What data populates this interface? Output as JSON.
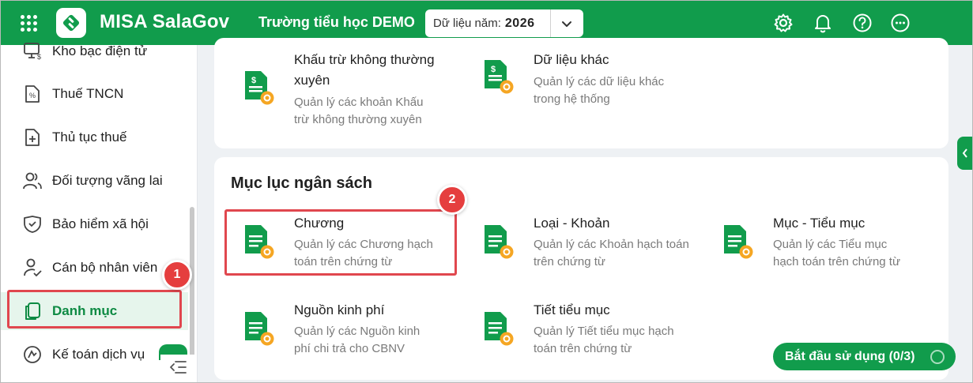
{
  "header": {
    "brand": "MISA SalaGov",
    "org": "Trường tiểu học DEMO",
    "year_label": "Dữ liệu năm:",
    "year_value": "2026",
    "icons": [
      "apps-icon",
      "settings-icon",
      "bell-icon",
      "help-icon",
      "more-icon"
    ],
    "colors": {
      "brand_green": "#119c4c",
      "badge_red": "#e53e3e"
    }
  },
  "sidebar": {
    "items": [
      {
        "label": "Kho bạc điện tử",
        "icon": "treasury-monitor-icon"
      },
      {
        "label": "Thuế TNCN",
        "icon": "tax-document-icon"
      },
      {
        "label": "Thủ tục thuế",
        "icon": "add-document-icon"
      },
      {
        "label": "Đối tượng vãng lai",
        "icon": "people-icon"
      },
      {
        "label": "Bảo hiểm xã hội",
        "icon": "insurance-shield-icon"
      },
      {
        "label": "Cán bộ nhân viên",
        "icon": "user-check-icon"
      },
      {
        "label": "Danh mục",
        "icon": "catalog-icon",
        "active": true
      },
      {
        "label": "Kế toán dịch vụ",
        "icon": "accounting-icon"
      }
    ],
    "step_badge": "1"
  },
  "card_top": {
    "items": [
      {
        "title_line1": "Khấu trừ không thường",
        "title_line2": "xuyên",
        "desc": "Quản lý các khoản Khấu trừ không thường xuyên"
      },
      {
        "title_line1": "Dữ liệu khác",
        "desc": "Quản lý các dữ liệu khác trong hệ thống"
      }
    ]
  },
  "budget_card": {
    "title": "Mục lục ngân sách",
    "step_badge": "2",
    "items": [
      {
        "title": "Chương",
        "desc": "Quản lý các Chương hạch toán trên chứng từ"
      },
      {
        "title": "Loại - Khoản",
        "desc": "Quản lý các Khoản hạch toán trên chứng từ"
      },
      {
        "title": "Mục - Tiểu mục",
        "desc": "Quản lý các Tiểu mục hạch toán trên chứng từ"
      },
      {
        "title": "Nguồn kinh phí",
        "desc": "Quản lý các Nguồn kinh phí chi trả cho CBNV"
      },
      {
        "title": "Tiết tiểu mục",
        "desc": "Quản lý Tiết tiểu mục hạch toán trên chứng từ"
      }
    ]
  },
  "start_button": {
    "label": "Bắt đầu sử dụng (0/3)"
  }
}
